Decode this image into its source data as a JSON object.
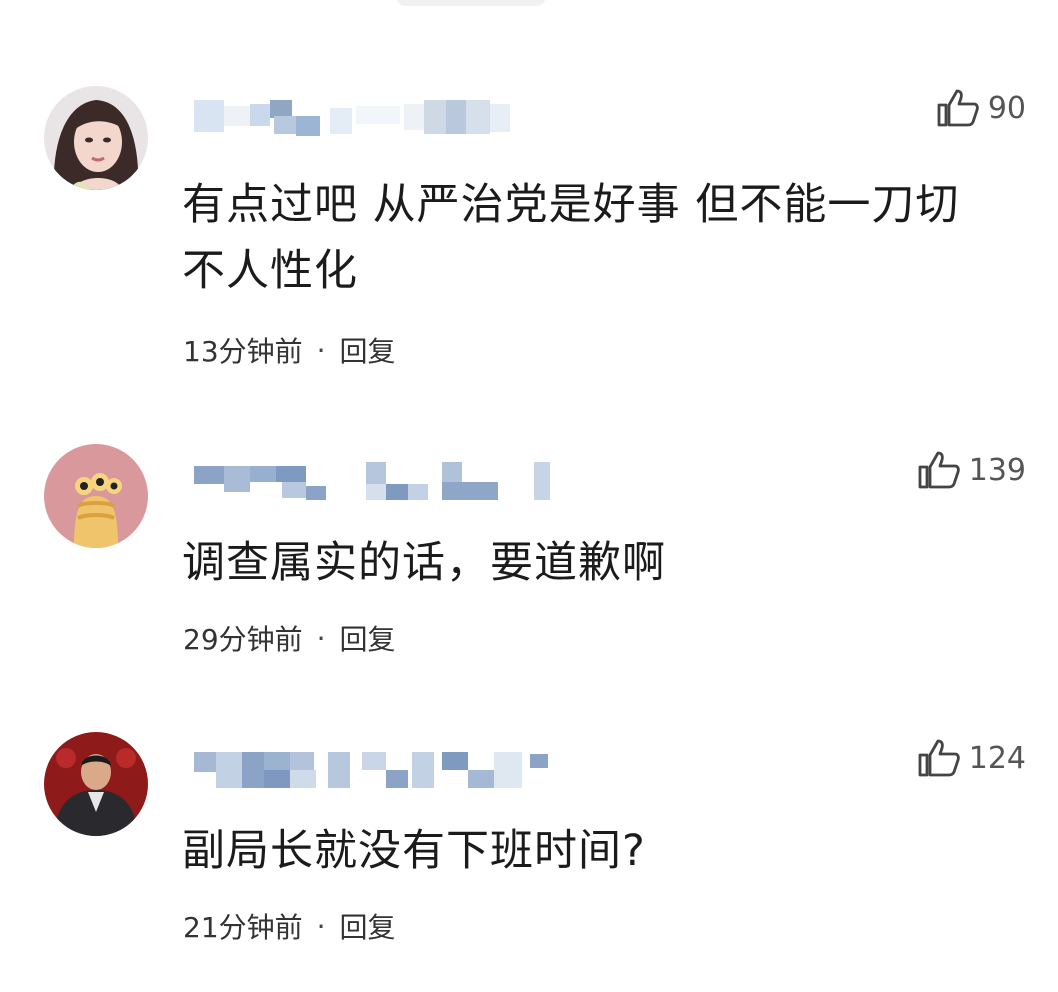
{
  "comments": [
    {
      "avatar": "woman-portrait-avatar",
      "likes": "90",
      "text": "有点过吧 从严治党是好事 但不能一刀切 不人性化",
      "time": "13分钟前",
      "separator": "·",
      "reply": "回复"
    },
    {
      "avatar": "cartoon-creature-avatar",
      "likes": "139",
      "text": "调查属实的话，要道歉啊",
      "time": "29分钟前",
      "separator": "·",
      "reply": "回复"
    },
    {
      "avatar": "man-in-red-chair-avatar",
      "likes": "124",
      "text": "副局长就没有下班时间?",
      "time": "21分钟前",
      "separator": "·",
      "reply": "回复"
    }
  ],
  "icons": {
    "like": "thumbs-up-icon"
  },
  "colors": {
    "text": "#1b1b1b",
    "meta": "#333333",
    "likes": "#555555",
    "blur": "#9fb6d6"
  }
}
